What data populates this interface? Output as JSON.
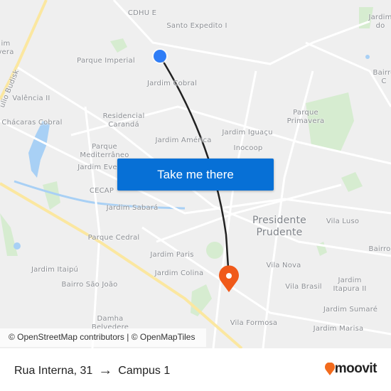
{
  "map": {
    "labels": [
      "CDHU E",
      "Santo Expedito I",
      "Parque Imperial",
      "Jardim Cobral",
      "Valência II",
      "Residencial\nCarandá",
      "Chácaras Cobral",
      "Jardim América",
      "Jardim Iguaçu",
      "Inocoop",
      "Parque\nPrimavera",
      "Parque\nMediterrâneo",
      "Jardim Eve",
      "CECAP",
      "Jardim Sabará",
      "Vila Luso",
      "Parque Cedral",
      "Bairro",
      "Jardim Paris",
      "Vila Nova",
      "Jardim Itaipú",
      "Jardim Colina",
      "Jardim\nItapura II",
      "Bairro São João",
      "Vila Brasil",
      "Jardim Sumaré",
      "Damha\nBelvedere",
      "Vila Formosa",
      "Jardim Marisa",
      "Jardim\ndo",
      "Bairro\nC",
      "im\nvera",
      "ulio Budisk"
    ],
    "city": "Presidente\nPrudente",
    "attribution": "© OpenStreetMap contributors | © OpenMapTiles",
    "origin_color": "#2f7df6",
    "destination_color": "#f05a1a",
    "route_color": "#222222"
  },
  "cta": {
    "label": "Take me there",
    "color": "#0770d6"
  },
  "footer": {
    "origin": "Rua Interna, 31",
    "arrow": "→",
    "destination": "Campus 1",
    "brand": "moovit",
    "brand_color": "#f26b1d"
  }
}
